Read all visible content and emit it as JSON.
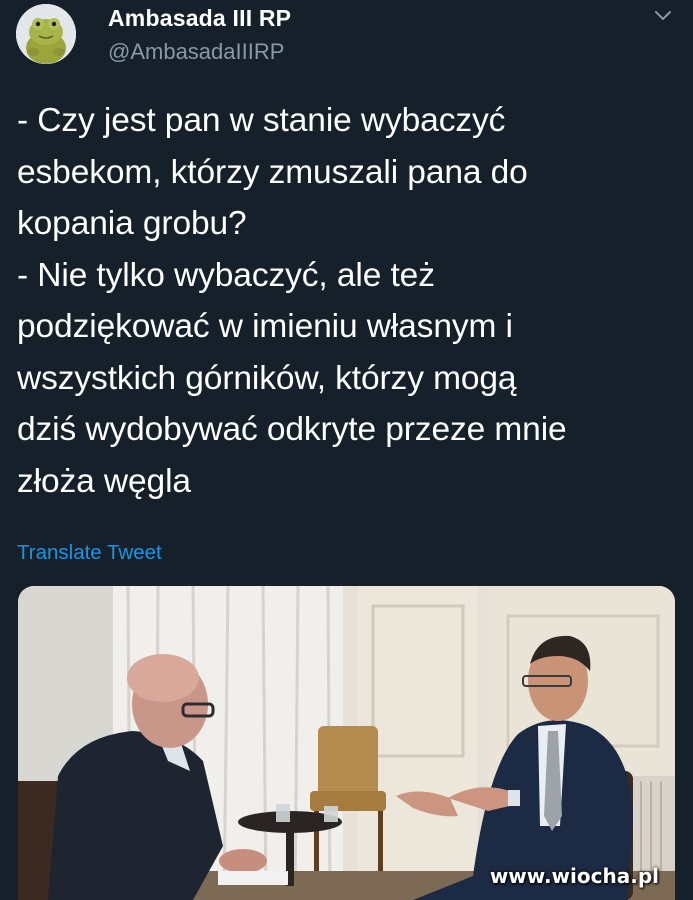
{
  "author": {
    "display_name": "Ambasada III RP",
    "handle": "@AmbasadaIIIRP",
    "avatar_icon": "frog-plush-avatar"
  },
  "menu_icon": "chevron-down-icon",
  "tweet": {
    "text": "- Czy jest pan w stanie wybaczyć\nesbekom, którzy zmuszali pana do\nkopania grobu?\n- Nie tylko wybaczyć, ale też\npodziękować w imieniu własnym i\nwszystkich górników, którzy mogą\ndziś wydobywać odkryte przeze mnie\nzłoża węgla",
    "translate_label": "Translate Tweet"
  },
  "media": {
    "description_icon": "interview-photo",
    "watermark": "www.wiocha.pl"
  },
  "colors": {
    "background": "#15202b",
    "text": "#ffffff",
    "secondary_text": "#8899a6",
    "link": "#1b95e0"
  }
}
